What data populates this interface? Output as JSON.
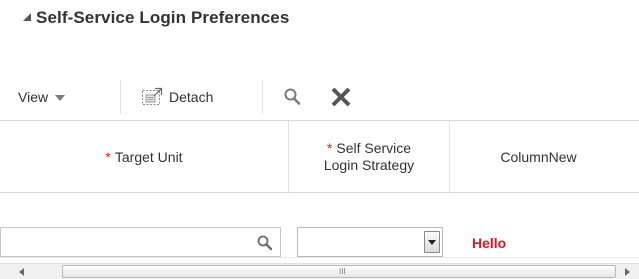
{
  "section": {
    "title": "Self-Service Login Preferences"
  },
  "toolbar": {
    "view_label": "View",
    "detach_label": "Detach",
    "icons": {
      "view_menu": "chevron-down-icon",
      "detach": "detach-icon",
      "search": "search-icon",
      "clear": "close-icon"
    }
  },
  "table": {
    "columns": [
      {
        "required_mark": "*",
        "label": "Target Unit"
      },
      {
        "required_mark": "*",
        "label_line1": "Self Service",
        "label_line2": "Login Strategy"
      },
      {
        "label": "ColumnNew"
      }
    ],
    "rows": [
      {
        "target_unit_value": "",
        "login_strategy_selected": "",
        "column_new": "Hello"
      }
    ]
  },
  "scrollbar": {
    "grip": "III"
  },
  "colors": {
    "required": "#e02020",
    "hello_text": "#e8101a",
    "clear_icon": "#555555"
  }
}
